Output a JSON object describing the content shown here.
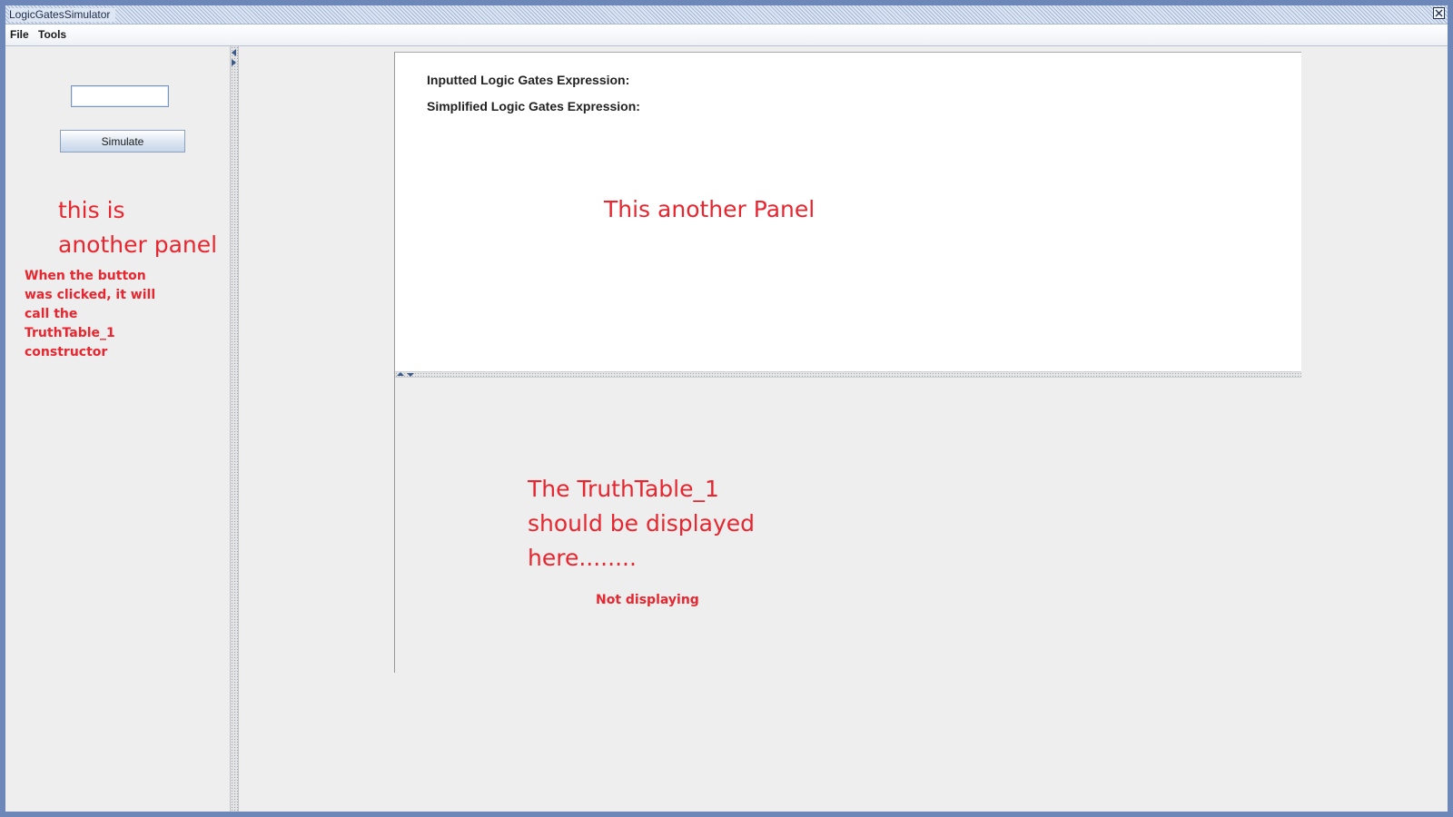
{
  "window": {
    "title": "LogicGatesSimulator"
  },
  "menubar": {
    "items": [
      "File",
      "Tools"
    ]
  },
  "left_panel": {
    "input_value": "",
    "simulate_label": "Simulate",
    "annotation_title_1": "this is",
    "annotation_title_2": "another panel",
    "annotation_note": [
      "When the button",
      "was clicked, it will",
      "call the",
      "TruthTable_1",
      "constructor"
    ]
  },
  "top_panel": {
    "inputted_label": "Inputted Logic Gates Expression:",
    "simplified_label": "Simplified Logic Gates Expression:",
    "annotation": "This another Panel"
  },
  "bottom_panel": {
    "annotation": [
      "The TruthTable_1",
      "should be displayed",
      "here........"
    ],
    "status_note": "Not displaying"
  },
  "colors": {
    "annotation": "#e8262f",
    "title_bar": "#dde6f3",
    "frame": "#6d87b8"
  }
}
